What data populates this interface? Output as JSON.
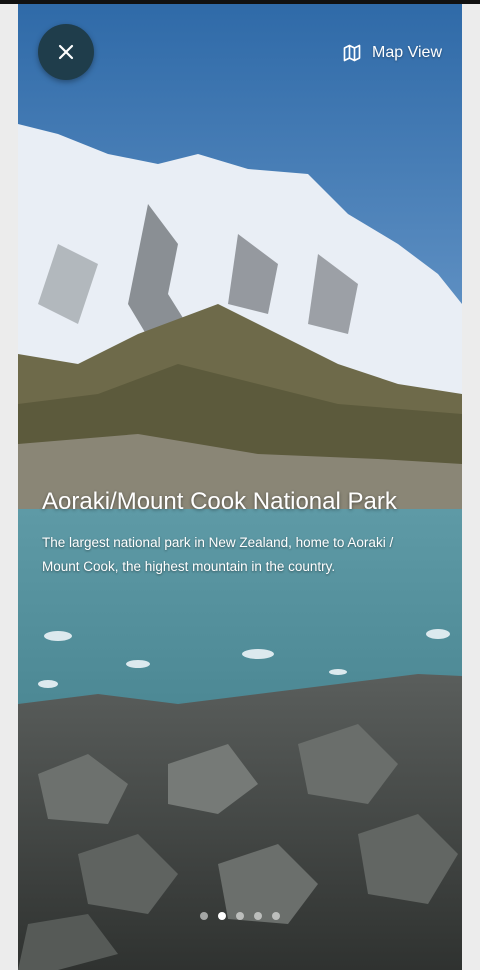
{
  "header": {
    "close_icon": "close-icon",
    "map_icon": "map-icon",
    "map_label": "Map View"
  },
  "park": {
    "title": "Aoraki/Mount Cook National Park",
    "description": "The largest national park in New Zealand, home to Aoraki / Mount Cook, the highest mountain in the country."
  },
  "pagination": {
    "count": 5,
    "active_index": 1
  },
  "colors": {
    "close_button_bg": "#1f3d4b",
    "text": "#ffffff"
  }
}
